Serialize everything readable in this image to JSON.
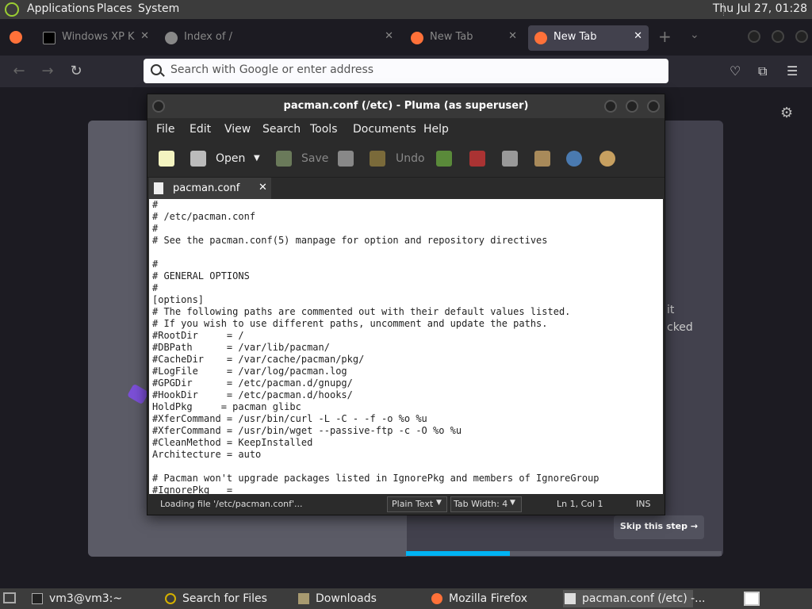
{
  "top_panel": {
    "menus": [
      "Applications",
      "Places",
      "System"
    ],
    "clock": "Thu Jul 27, 01:28"
  },
  "firefox": {
    "tabs": [
      {
        "label": "Windows XP K",
        "active": false
      },
      {
        "label": "Index of /",
        "active": false
      },
      {
        "label": "New Tab",
        "active": false
      },
      {
        "label": "New Tab",
        "active": true
      }
    ],
    "url_placeholder": "Search with Google or enter address",
    "page": {
      "partial_text_line1": "it",
      "partial_text_line2": "cked",
      "skip_button": "Skip this step →",
      "progress_fraction": 0.33
    }
  },
  "pluma": {
    "title": "pacman.conf (/etc) - Pluma (as superuser)",
    "menus": [
      "File",
      "Edit",
      "View",
      "Search",
      "Tools",
      "Documents",
      "Help"
    ],
    "toolbar": {
      "open": "Open",
      "save": "Save",
      "undo": "Undo"
    },
    "tab_label": "pacman.conf",
    "editor_lines": [
      "#",
      "# /etc/pacman.conf",
      "#",
      "# See the pacman.conf(5) manpage for option and repository directives",
      "",
      "#",
      "# GENERAL OPTIONS",
      "#",
      "[options]",
      "# The following paths are commented out with their default values listed.",
      "# If you wish to use different paths, uncomment and update the paths.",
      "#RootDir     = /",
      "#DBPath      = /var/lib/pacman/",
      "#CacheDir    = /var/cache/pacman/pkg/",
      "#LogFile     = /var/log/pacman.log",
      "#GPGDir      = /etc/pacman.d/gnupg/",
      "#HookDir     = /etc/pacman.d/hooks/",
      "HoldPkg     = pacman glibc",
      "#XferCommand = /usr/bin/curl -L -C - -f -o %o %u",
      "#XferCommand = /usr/bin/wget --passive-ftp -c -O %o %u",
      "#CleanMethod = KeepInstalled",
      "Architecture = auto",
      "",
      "# Pacman won't upgrade packages listed in IgnorePkg and members of IgnoreGroup",
      "#IgnorePkg   ="
    ],
    "status": {
      "message": "Loading file '/etc/pacman.conf'...",
      "syntax": "Plain Text",
      "tab_width": "Tab Width:  4",
      "position": "Ln 1, Col 1",
      "mode": "INS"
    }
  },
  "taskbar": {
    "items": [
      {
        "label": "vm3@vm3:~",
        "active": false
      },
      {
        "label": "Search for Files",
        "active": false
      },
      {
        "label": "Downloads",
        "active": false
      },
      {
        "label": "Mozilla Firefox",
        "active": false
      },
      {
        "label": "pacman.conf (/etc) -...",
        "active": true
      }
    ]
  }
}
